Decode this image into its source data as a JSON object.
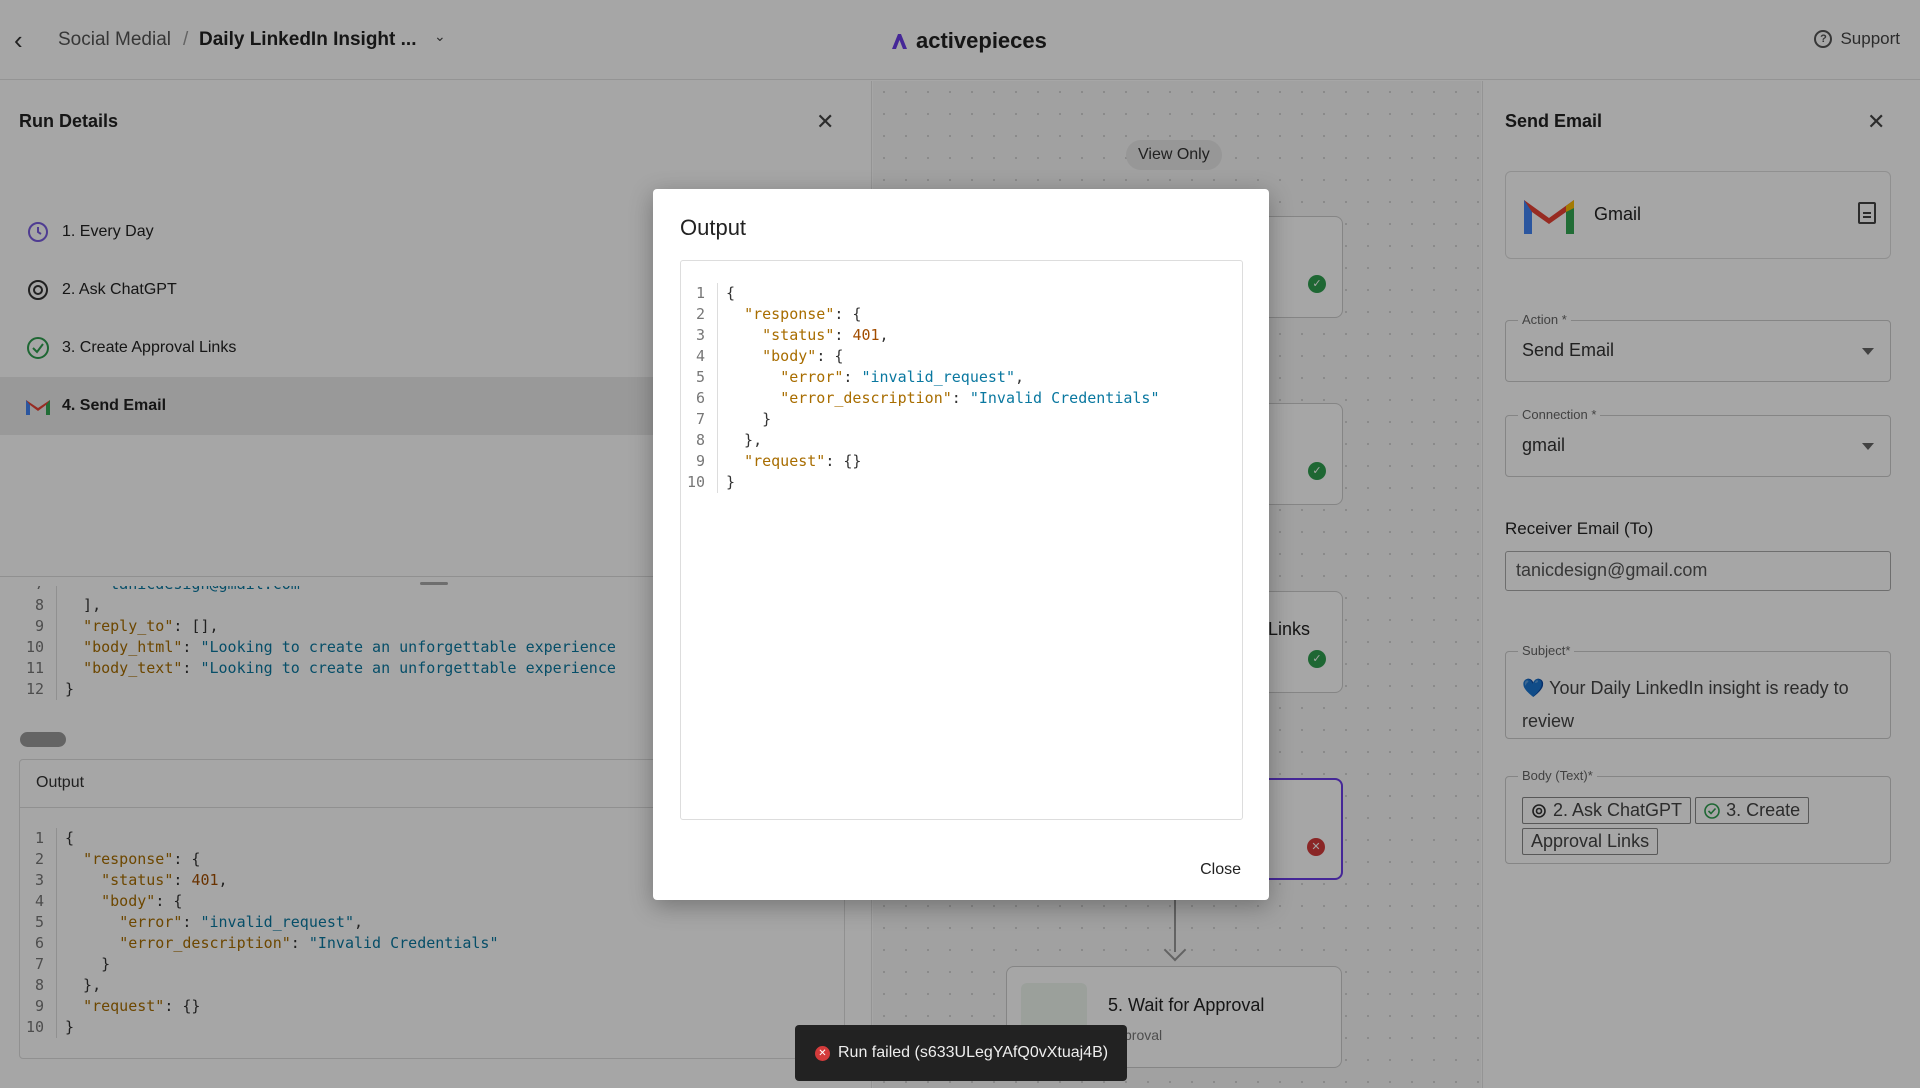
{
  "header": {
    "back_label": "‹",
    "breadcrumb_folder": "Social Medial",
    "breadcrumb_sep": "/",
    "breadcrumb_flow": "Daily LinkedIn Insight ...",
    "brand": "activepieces",
    "support": "Support"
  },
  "run_details": {
    "title": "Run Details",
    "steps": [
      {
        "label": "1. Every Day",
        "icon": "clock-icon",
        "status": "success"
      },
      {
        "label": "2. Ask ChatGPT",
        "icon": "openai-icon"
      },
      {
        "label": "3. Create Approval Links",
        "icon": "check-circle-icon"
      },
      {
        "label": "4. Send Email",
        "icon": "gmail-icon",
        "active": true
      }
    ],
    "input_code_partial": [
      {
        "ln": "7",
        "text": "    \"tanicdesign@gmail.com\""
      },
      {
        "ln": "8",
        "text": "  ],"
      },
      {
        "ln": "9",
        "key": "\"reply_to\"",
        "rest": ": [],"
      },
      {
        "ln": "10",
        "key": "\"body_html\"",
        "str": "\"Looking to create an unforgettable experience"
      },
      {
        "ln": "11",
        "key": "\"body_text\"",
        "str": "\"Looking to create an unforgettable experience"
      },
      {
        "ln": "12",
        "text": "}"
      }
    ],
    "output_label": "Output"
  },
  "json_output": {
    "lines": [
      "1",
      "2",
      "3",
      "4",
      "5",
      "6",
      "7",
      "8",
      "9",
      "10"
    ],
    "response_key": "\"response\"",
    "status_key": "\"status\"",
    "status_val": "401",
    "body_key": "\"body\"",
    "error_key": "\"error\"",
    "error_val": "\"invalid_request\"",
    "desc_key": "\"error_description\"",
    "desc_val": "\"Invalid Credentials\"",
    "request_key": "\"request\"",
    "request_val": "{}"
  },
  "canvas": {
    "view_only": "View Only",
    "node3_title_fragment": "Links",
    "node5_title": "5. Wait for Approval",
    "node5_sub_fragment": "proval"
  },
  "send_email": {
    "title": "Send Email",
    "app_name": "Gmail",
    "action_label": "Action *",
    "action_value": "Send Email",
    "connection_label": "Connection *",
    "connection_value": "gmail",
    "receiver_label": "Receiver Email (To)",
    "receiver_value": "tanicdesign@gmail.com",
    "subject_label": "Subject*",
    "subject_value": "💙 Your Daily LinkedIn insight is ready to review",
    "body_label": "Body (Text)*",
    "body_chip1": "2. Ask ChatGPT",
    "body_chip2": "3. Create",
    "body_chip2_cont": "Approval Links"
  },
  "modal": {
    "title": "Output",
    "close_label": "Close"
  },
  "toast": {
    "message": "Run failed (s633ULegYAfQ0vXtuaj4B)"
  },
  "colors": {
    "accent": "#6a3de8",
    "success": "#2e9e4f",
    "error": "#d43b3b"
  }
}
